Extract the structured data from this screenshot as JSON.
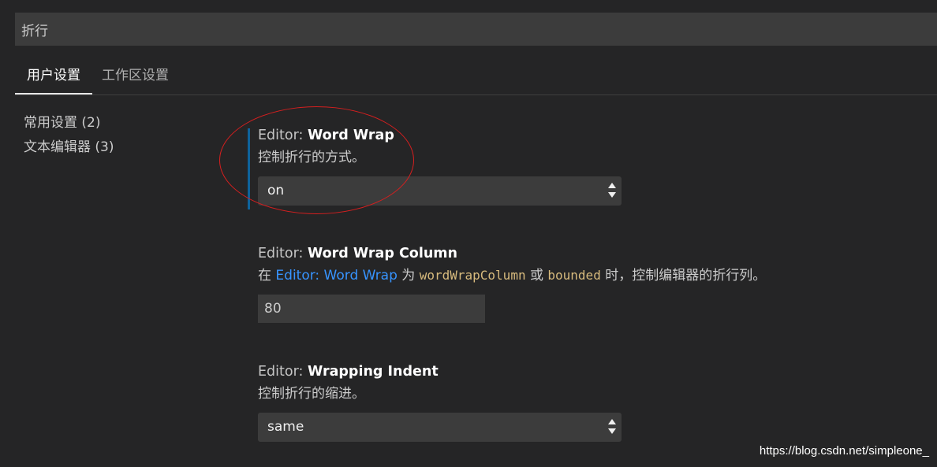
{
  "search": {
    "value": "折行"
  },
  "tabs": {
    "user": "用户设置",
    "workspace": "工作区设置"
  },
  "toc": [
    {
      "label": "常用设置 (2)"
    },
    {
      "label": "文本编辑器 (3)"
    }
  ],
  "settings": {
    "word_wrap": {
      "category": "Editor: ",
      "name": "Word Wrap",
      "description": "控制折行的方式。",
      "value": "on"
    },
    "word_wrap_column": {
      "category": "Editor: ",
      "name": "Word Wrap Column",
      "desc_prefix": "在 ",
      "desc_link": "Editor: Word Wrap",
      "desc_mid1": " 为 ",
      "desc_code1": "wordWrapColumn",
      "desc_mid2": " 或 ",
      "desc_code2": "bounded",
      "desc_suffix": " 时，控制编辑器的折行列。",
      "value": "80"
    },
    "wrapping_indent": {
      "category": "Editor: ",
      "name": "Wrapping Indent",
      "description": "控制折行的缩进。",
      "value": "same"
    }
  },
  "colors": {
    "background": "#252526",
    "input_background": "#3c3c3c",
    "link": "#3794ff",
    "code": "#d7ba7d",
    "modified_indicator": "#0e639c",
    "annotation_circle": "#d61f1f"
  },
  "icons": {
    "select_arrows": "up-down-arrows-icon"
  },
  "watermark": "https://blog.csdn.net/simpleone_"
}
